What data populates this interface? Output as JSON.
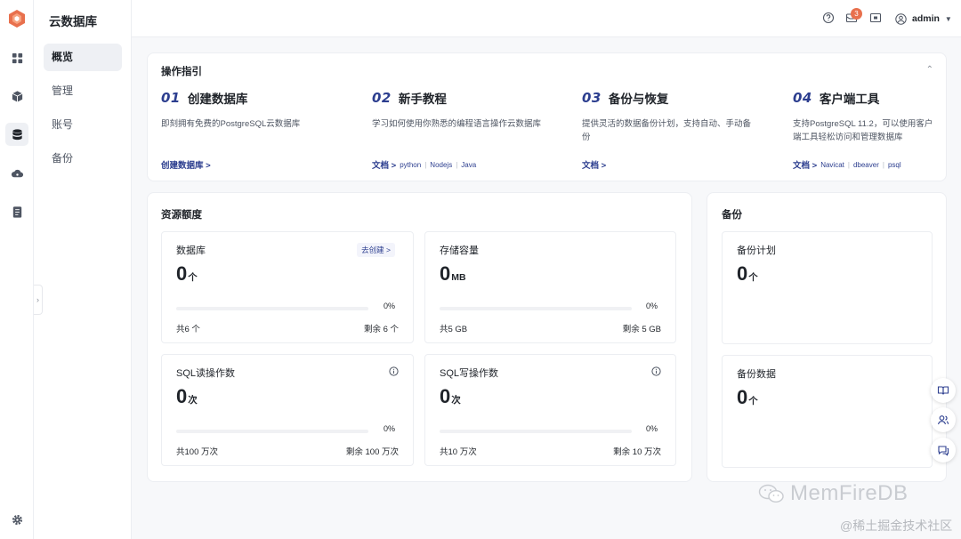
{
  "app": {
    "title": "云数据库"
  },
  "sidebar": {
    "items": [
      {
        "label": "概览"
      },
      {
        "label": "管理"
      },
      {
        "label": "账号"
      },
      {
        "label": "备份"
      }
    ]
  },
  "header": {
    "notification_count": "3",
    "username": "admin"
  },
  "guide": {
    "title": "操作指引",
    "steps": [
      {
        "num": "01",
        "title": "创建数据库",
        "desc": "即刻拥有免费的PostgreSQL云数据库",
        "link": "创建数据库 >",
        "extras": []
      },
      {
        "num": "02",
        "title": "新手教程",
        "desc": "学习如何使用你熟悉的编程语言操作云数据库",
        "link": "文档 >",
        "extras": [
          "python",
          "Nodejs",
          "Java"
        ]
      },
      {
        "num": "03",
        "title": "备份与恢复",
        "desc": "提供灵活的数据备份计划，支持自动、手动备份",
        "link": "文档 >",
        "extras": []
      },
      {
        "num": "04",
        "title": "客户端工具",
        "desc": "支持PostgreSQL 11.2，可以使用客户端工具轻松访问和管理数据库",
        "link": "文档 >",
        "extras": [
          "Navicat",
          "dbeaver",
          "psql"
        ]
      }
    ]
  },
  "quota": {
    "title": "资源额度",
    "cards": [
      {
        "label": "数据库",
        "value": "0",
        "unit": "个",
        "percent_text": "0%",
        "percent": 0,
        "total": "共6 个",
        "remain": "剩余 6 个",
        "link": "去创建 >"
      },
      {
        "label": "存储容量",
        "value": "0",
        "unit": "MB",
        "percent_text": "0%",
        "percent": 0,
        "total": "共5 GB",
        "remain": "剩余 5 GB"
      },
      {
        "label": "SQL读操作数",
        "value": "0",
        "unit": "次",
        "percent_text": "0%",
        "percent": 0,
        "total": "共100 万次",
        "remain": "剩余 100 万次"
      },
      {
        "label": "SQL写操作数",
        "value": "0",
        "unit": "次",
        "percent_text": "0%",
        "percent": 0,
        "total": "共10 万次",
        "remain": "剩余 10 万次"
      }
    ]
  },
  "backup": {
    "title": "备份",
    "cards": [
      {
        "label": "备份计划",
        "value": "0",
        "unit": "个"
      },
      {
        "label": "备份数据",
        "value": "0",
        "unit": "个"
      }
    ]
  },
  "watermark": {
    "brand": "MemFireDB",
    "source": "@稀土掘金技术社区"
  },
  "colors": {
    "accent": "#2c3e8f",
    "badge": "#e8704d",
    "logo": "#e8704d"
  }
}
